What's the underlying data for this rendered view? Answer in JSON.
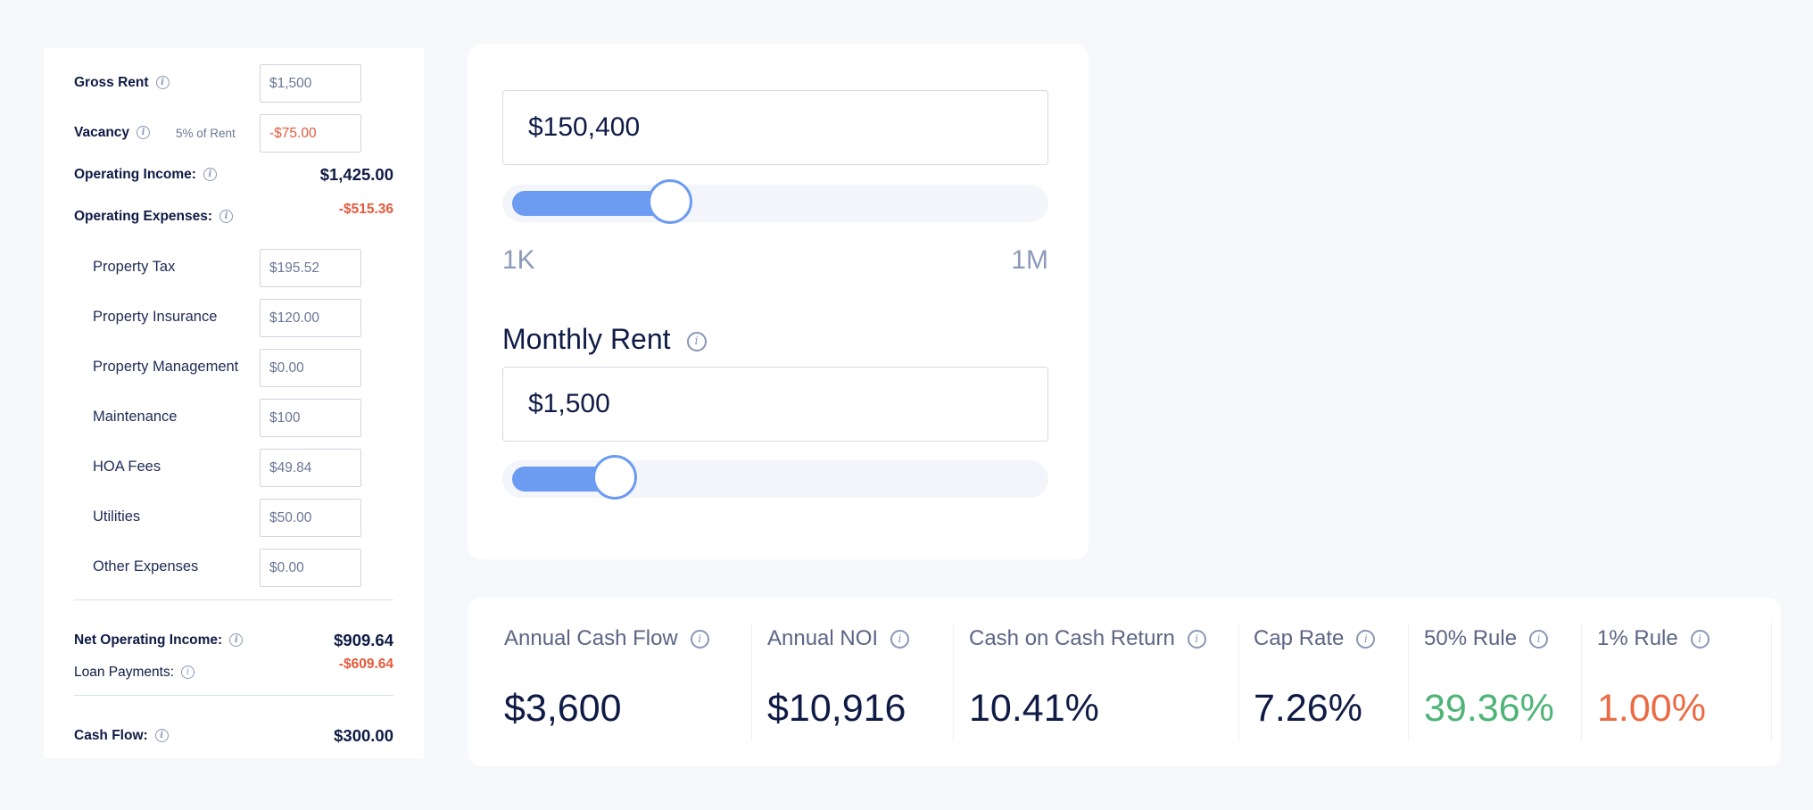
{
  "left_panel": {
    "gross_rent": {
      "label": "Gross Rent",
      "value": "$1,500"
    },
    "vacancy": {
      "label": "Vacancy",
      "note": "5% of Rent",
      "value": "-$75.00"
    },
    "operating_income": {
      "label": "Operating Income:",
      "value": "$1,425.00"
    },
    "operating_expenses": {
      "label": "Operating Expenses:",
      "value": "-$515.36"
    },
    "expenses": [
      {
        "label": "Property Tax",
        "value": "$195.52"
      },
      {
        "label": "Property Insurance",
        "value": "$120.00"
      },
      {
        "label": "Property Management",
        "value": "$0.00"
      },
      {
        "label": "Maintenance",
        "value": "$100"
      },
      {
        "label": "HOA Fees",
        "value": "$49.84"
      },
      {
        "label": "Utilities",
        "value": "$50.00"
      },
      {
        "label": "Other Expenses",
        "value": "$0.00"
      }
    ],
    "net_operating_income": {
      "label": "Net Operating Income:",
      "value": "$909.64"
    },
    "loan_payments": {
      "label": "Loan Payments:",
      "value": "-$609.64"
    },
    "cash_flow": {
      "label": "Cash Flow:",
      "value": "$300.00"
    }
  },
  "purchase_price": {
    "value": "$150,400",
    "slider_fraction": 0.29,
    "min_label": "1K",
    "max_label": "1M"
  },
  "monthly_rent": {
    "title": "Monthly Rent",
    "value": "$1,500",
    "slider_fraction": 0.18
  },
  "metrics": [
    {
      "label": "Annual Cash Flow",
      "value": "$3,600",
      "color": "#0f1b45"
    },
    {
      "label": "Annual NOI",
      "value": "$10,916",
      "color": "#0f1b45"
    },
    {
      "label": "Cash on Cash Return",
      "value": "10.41%",
      "color": "#0f1b45"
    },
    {
      "label": "Cap Rate",
      "value": "7.26%",
      "color": "#0f1b45"
    },
    {
      "label": "50% Rule",
      "value": "39.36%",
      "color": "#4fb477"
    },
    {
      "label": "1% Rule",
      "value": "1.00%",
      "color": "#ec6a43"
    }
  ],
  "colors": {
    "accent": "#6c9bf2",
    "negative": "#e8583a",
    "positive": "#4fb477"
  },
  "icons": {
    "info": "info-circle-icon"
  }
}
